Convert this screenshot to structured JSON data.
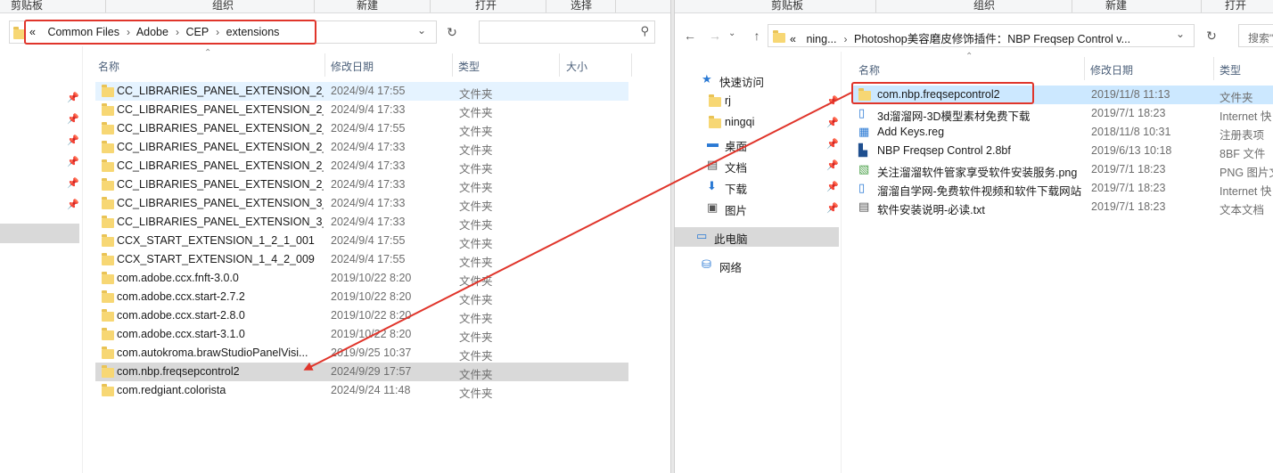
{
  "left": {
    "ribbon": [
      "剪贴板",
      "组织",
      "新建",
      "打开",
      "选择"
    ],
    "breadcrumb": [
      "«",
      "Common Files",
      "Adobe",
      "CEP",
      "extensions"
    ],
    "columns": {
      "name": "名称",
      "date": "修改日期",
      "type": "类型",
      "size": "大小"
    },
    "files": [
      {
        "name": "CC_LIBRARIES_PANEL_EXTENSION_2_...",
        "date": "2024/9/4 17:55",
        "type": "文件夹"
      },
      {
        "name": "CC_LIBRARIES_PANEL_EXTENSION_2_...",
        "date": "2024/9/4 17:33",
        "type": "文件夹"
      },
      {
        "name": "CC_LIBRARIES_PANEL_EXTENSION_2_...",
        "date": "2024/9/4 17:55",
        "type": "文件夹"
      },
      {
        "name": "CC_LIBRARIES_PANEL_EXTENSION_2_...",
        "date": "2024/9/4 17:33",
        "type": "文件夹"
      },
      {
        "name": "CC_LIBRARIES_PANEL_EXTENSION_2_...",
        "date": "2024/9/4 17:33",
        "type": "文件夹"
      },
      {
        "name": "CC_LIBRARIES_PANEL_EXTENSION_2_...",
        "date": "2024/9/4 17:33",
        "type": "文件夹"
      },
      {
        "name": "CC_LIBRARIES_PANEL_EXTENSION_3_...",
        "date": "2024/9/4 17:33",
        "type": "文件夹"
      },
      {
        "name": "CC_LIBRARIES_PANEL_EXTENSION_3_...",
        "date": "2024/9/4 17:33",
        "type": "文件夹"
      },
      {
        "name": "CCX_START_EXTENSION_1_2_1_001",
        "date": "2024/9/4 17:55",
        "type": "文件夹"
      },
      {
        "name": "CCX_START_EXTENSION_1_4_2_009",
        "date": "2024/9/4 17:55",
        "type": "文件夹"
      },
      {
        "name": "com.adobe.ccx.fnft-3.0.0",
        "date": "2019/10/22 8:20",
        "type": "文件夹"
      },
      {
        "name": "com.adobe.ccx.start-2.7.2",
        "date": "2019/10/22 8:20",
        "type": "文件夹"
      },
      {
        "name": "com.adobe.ccx.start-2.8.0",
        "date": "2019/10/22 8:20",
        "type": "文件夹"
      },
      {
        "name": "com.adobe.ccx.start-3.1.0",
        "date": "2019/10/22 8:20",
        "type": "文件夹"
      },
      {
        "name": "com.autokroma.brawStudioPanelVisi...",
        "date": "2019/9/25 10:37",
        "type": "文件夹"
      },
      {
        "name": "com.nbp.freqsepcontrol2",
        "date": "2024/9/29 17:57",
        "type": "文件夹"
      },
      {
        "name": "com.redgiant.colorista",
        "date": "2024/9/24 11:48",
        "type": "文件夹"
      }
    ]
  },
  "right": {
    "ribbon": [
      "剪贴板",
      "组织",
      "新建",
      "打开"
    ],
    "breadcrumb": [
      "«",
      "ning...",
      "Photoshop美容磨皮修饰插件：NBP Freqsep Control v..."
    ],
    "search_placeholder": "搜索\"",
    "columns": {
      "name": "名称",
      "date": "修改日期",
      "type": "类型"
    },
    "nav": [
      {
        "label": "快速访问",
        "icon": "star-icon"
      },
      {
        "label": "rj",
        "icon": "folder-icon"
      },
      {
        "label": "ningqi",
        "icon": "folder-icon"
      },
      {
        "label": "桌面",
        "icon": "desktop-icon"
      },
      {
        "label": "文档",
        "icon": "document-icon"
      },
      {
        "label": "下载",
        "icon": "download-icon"
      },
      {
        "label": "图片",
        "icon": "picture-icon"
      },
      {
        "label": "此电脑",
        "icon": "computer-icon"
      },
      {
        "label": "网络",
        "icon": "network-icon"
      }
    ],
    "files": [
      {
        "name": "com.nbp.freqsepcontrol2",
        "date": "2019/11/8 11:13",
        "type": "文件夹",
        "icon": "folder-icon"
      },
      {
        "name": "3d溜溜网-3D模型素材免费下载",
        "date": "2019/7/1 18:23",
        "type": "Internet 快",
        "icon": "internet-shortcut-icon"
      },
      {
        "name": "Add Keys.reg",
        "date": "2018/11/8 10:31",
        "type": "注册表项",
        "icon": "registry-icon"
      },
      {
        "name": "NBP Freqsep Control 2.8bf",
        "date": "2019/6/13 10:18",
        "type": "8BF 文件",
        "icon": "plugin-file-icon"
      },
      {
        "name": "关注溜溜软件管家享受软件安装服务.png",
        "date": "2019/7/1 18:23",
        "type": "PNG 图片文",
        "icon": "png-image-icon"
      },
      {
        "name": "溜溜自学网-免费软件视频和软件下载网站",
        "date": "2019/7/1 18:23",
        "type": "Internet 快",
        "icon": "internet-shortcut-icon"
      },
      {
        "name": "软件安装说明-必读.txt",
        "date": "2019/7/1 18:23",
        "type": "文本文档",
        "icon": "text-file-icon"
      }
    ]
  },
  "colors": {
    "annotation_red": "#e0352b",
    "selection_blue": "#cce8ff",
    "folder_yellow": "#f7d774"
  }
}
